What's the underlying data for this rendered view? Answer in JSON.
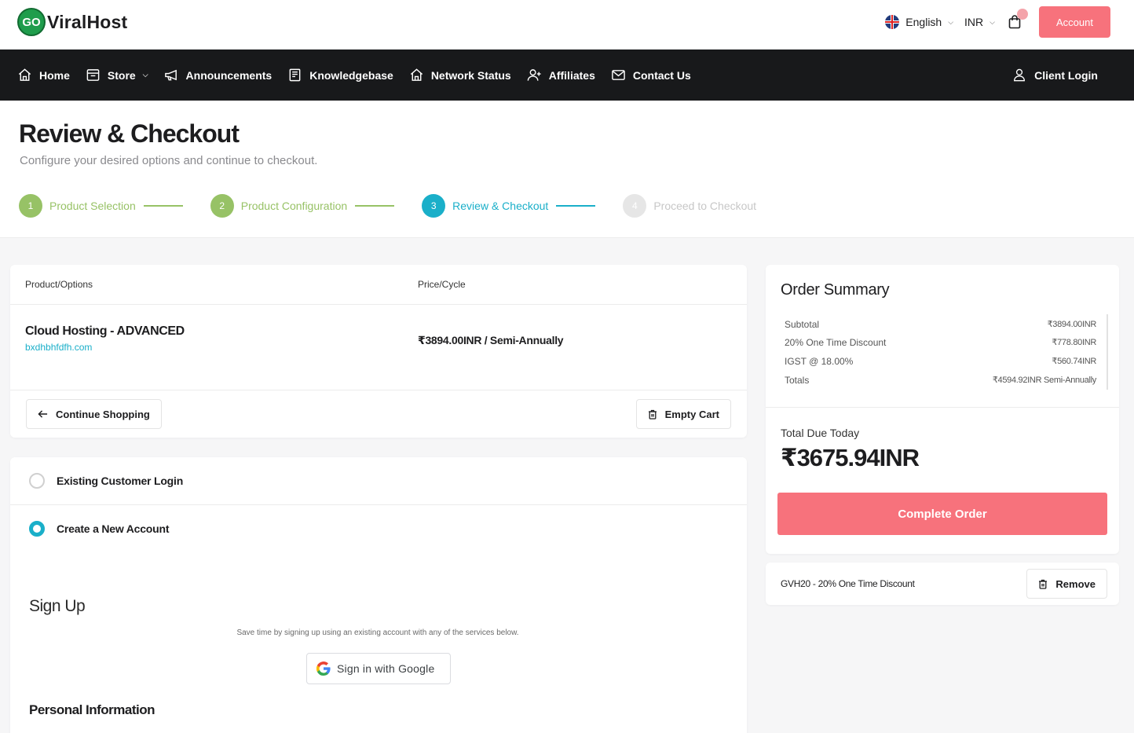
{
  "brand": {
    "badge": "GO",
    "name": "ViralHost"
  },
  "topbar": {
    "language": "English",
    "currency": "INR",
    "account_label": "Account"
  },
  "nav": {
    "items": [
      {
        "label": "Home",
        "icon": "home-icon"
      },
      {
        "label": "Store",
        "icon": "store-icon",
        "dropdown": true
      },
      {
        "label": "Announcements",
        "icon": "megaphone-icon"
      },
      {
        "label": "Knowledgebase",
        "icon": "book-icon"
      },
      {
        "label": "Network Status",
        "icon": "home-icon"
      },
      {
        "label": "Affiliates",
        "icon": "user-plus-icon"
      },
      {
        "label": "Contact Us",
        "icon": "mail-icon"
      }
    ],
    "client_login": "Client Login"
  },
  "page": {
    "title": "Review & Checkout",
    "subtitle": "Configure your desired options and continue to checkout."
  },
  "steps": [
    {
      "num": "1",
      "label": "Product Selection",
      "state": "done"
    },
    {
      "num": "2",
      "label": "Product Configuration",
      "state": "done"
    },
    {
      "num": "3",
      "label": "Review & Checkout",
      "state": "active"
    },
    {
      "num": "4",
      "label": "Proceed to Checkout",
      "state": "todo"
    }
  ],
  "cart": {
    "col_product": "Product/Options",
    "col_price": "Price/Cycle",
    "product_name": "Cloud Hosting - ADVANCED",
    "domain": "bxdhbhfdfh.com",
    "price": "₹3894.00INR / Semi-Annually",
    "continue_label": "Continue Shopping",
    "empty_label": "Empty Cart"
  },
  "auth": {
    "existing_label": "Existing Customer Login",
    "new_label": "Create a New Account",
    "signup_title": "Sign Up",
    "signup_sub": "Save time by signing up using an existing account with any of the services below.",
    "google_label": "Sign in with Google",
    "personal_title": "Personal Information"
  },
  "summary": {
    "title": "Order Summary",
    "rows": [
      {
        "label": "Subtotal",
        "value": "₹3894.00INR"
      },
      {
        "label": "20% One Time Discount",
        "value": "₹778.80INR"
      },
      {
        "label": "IGST @ 18.00%",
        "value": "₹560.74INR"
      },
      {
        "label": "Totals",
        "value": "₹4594.92INR Semi-Annually"
      }
    ],
    "due_label": "Total Due Today",
    "due_amount": "₹3675.94INR",
    "complete_label": "Complete Order"
  },
  "promo": {
    "text": "GVH20 - 20% One Time Discount",
    "remove_label": "Remove"
  },
  "colors": {
    "accent": "#f7727c",
    "teal": "#1aafc9",
    "green": "#97c266",
    "nav_bg": "#18191b"
  }
}
